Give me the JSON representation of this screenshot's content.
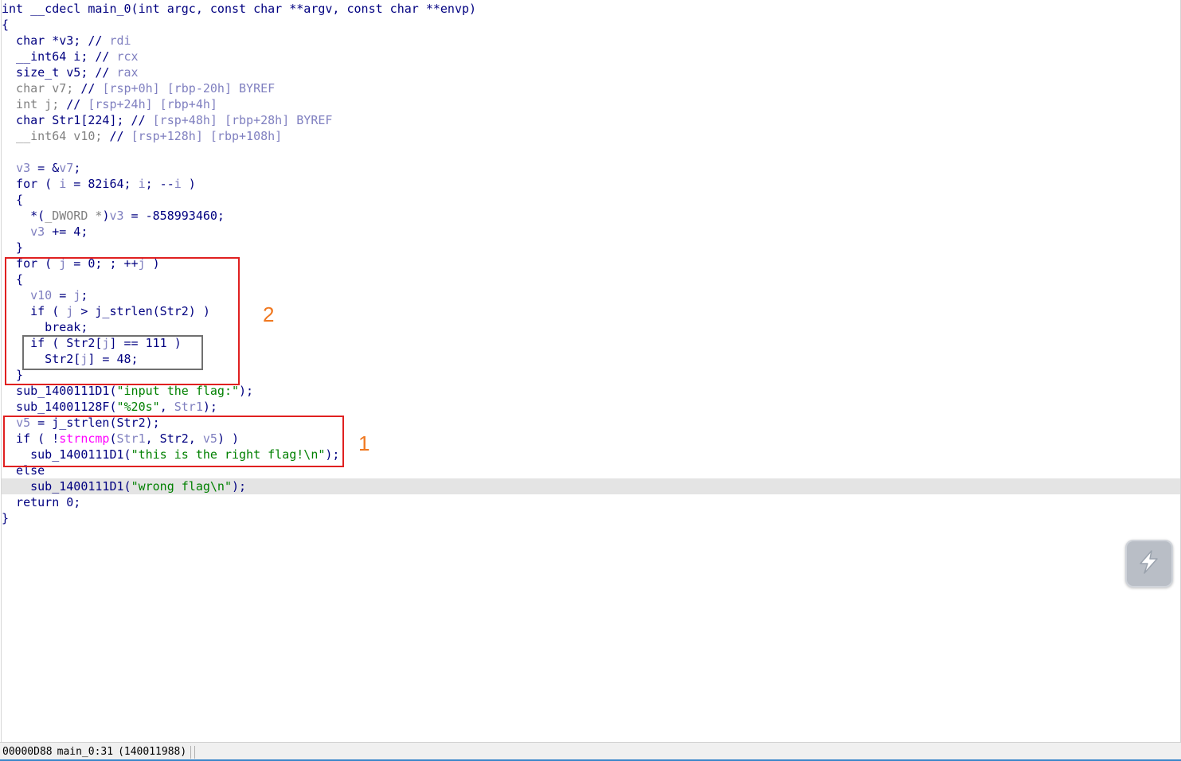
{
  "code_lines": [
    [
      [
        "int __cdecl main_0(int argc, const char **argv, const char **envp)",
        "kw"
      ]
    ],
    [
      [
        "{",
        "kw"
      ]
    ],
    [
      [
        "  char *v3; // ",
        "kw"
      ],
      [
        "rdi",
        "cmt"
      ]
    ],
    [
      [
        "  __int64 i; // ",
        "kw"
      ],
      [
        "rcx",
        "cmt"
      ]
    ],
    [
      [
        "  size_t v5; // ",
        "kw"
      ],
      [
        "rax",
        "cmt"
      ]
    ],
    [
      [
        "  char v7; ",
        "gray"
      ],
      [
        "// ",
        "kw"
      ],
      [
        "[rsp+0h] [rbp-20h] BYREF",
        "cmt"
      ]
    ],
    [
      [
        "  int j; ",
        "gray"
      ],
      [
        "// ",
        "kw"
      ],
      [
        "[rsp+24h] [rbp+4h]",
        "cmt"
      ]
    ],
    [
      [
        "  char Str1[224]; // ",
        "kw"
      ],
      [
        "[rsp+48h] [rbp+28h] BYREF",
        "cmt"
      ]
    ],
    [
      [
        "  __int64 v10; ",
        "gray"
      ],
      [
        "// ",
        "kw"
      ],
      [
        "[rsp+128h] [rbp+108h]",
        "cmt"
      ]
    ],
    [
      [
        "",
        "kw"
      ]
    ],
    [
      [
        "  ",
        "kw"
      ],
      [
        "v3",
        "var"
      ],
      [
        " = &",
        "kw"
      ],
      [
        "v7",
        "var"
      ],
      [
        ";",
        "kw"
      ]
    ],
    [
      [
        "  for ( ",
        "kw"
      ],
      [
        "i",
        "var"
      ],
      [
        " = 82i64; ",
        "kw"
      ],
      [
        "i",
        "var"
      ],
      [
        "; --",
        "kw"
      ],
      [
        "i",
        "var"
      ],
      [
        " )",
        "kw"
      ]
    ],
    [
      [
        "  {",
        "kw"
      ]
    ],
    [
      [
        "    *(",
        "kw"
      ],
      [
        "_DWORD *",
        "gray"
      ],
      [
        ")",
        "kw"
      ],
      [
        "v3",
        "var"
      ],
      [
        " = -858993460;",
        "kw"
      ]
    ],
    [
      [
        "    ",
        "kw"
      ],
      [
        "v3",
        "var"
      ],
      [
        " += 4;",
        "kw"
      ]
    ],
    [
      [
        "  }",
        "kw"
      ]
    ],
    [
      [
        "  for ( ",
        "kw"
      ],
      [
        "j",
        "var"
      ],
      [
        " = 0; ; ++",
        "kw"
      ],
      [
        "j",
        "var"
      ],
      [
        " )",
        "kw"
      ]
    ],
    [
      [
        "  {",
        "kw"
      ]
    ],
    [
      [
        "    ",
        "kw"
      ],
      [
        "v10",
        "var"
      ],
      [
        " = ",
        "kw"
      ],
      [
        "j",
        "var"
      ],
      [
        ";",
        "kw"
      ]
    ],
    [
      [
        "    if ( ",
        "kw"
      ],
      [
        "j",
        "var"
      ],
      [
        " > j_strlen(Str2) )",
        "kw"
      ]
    ],
    [
      [
        "      break;",
        "kw"
      ]
    ],
    [
      [
        "    if ( Str2[",
        "kw"
      ],
      [
        "j",
        "var"
      ],
      [
        "] == 111 )",
        "kw"
      ]
    ],
    [
      [
        "      Str2[",
        "kw"
      ],
      [
        "j",
        "var"
      ],
      [
        "] = 48;",
        "kw"
      ]
    ],
    [
      [
        "  }",
        "kw"
      ]
    ],
    [
      [
        "  sub_1400111D1(",
        "kw"
      ],
      [
        "\"input the flag:\"",
        "str"
      ],
      [
        ");",
        "kw"
      ]
    ],
    [
      [
        "  sub_14001128F(",
        "kw"
      ],
      [
        "\"%20s\"",
        "str"
      ],
      [
        ", ",
        "kw"
      ],
      [
        "Str1",
        "var"
      ],
      [
        ");",
        "kw"
      ]
    ],
    [
      [
        "  ",
        "kw"
      ],
      [
        "v5",
        "var"
      ],
      [
        " = j_strlen(Str2);",
        "kw"
      ]
    ],
    [
      [
        "  if ( !",
        "kw"
      ],
      [
        "strncmp",
        "imp"
      ],
      [
        "(",
        "kw"
      ],
      [
        "Str1",
        "var"
      ],
      [
        ", Str2, ",
        "kw"
      ],
      [
        "v5",
        "var"
      ],
      [
        ") )",
        "kw"
      ]
    ],
    [
      [
        "    sub_1400111D1(",
        "kw"
      ],
      [
        "\"this is the right flag!\\n\"",
        "str"
      ],
      [
        ");",
        "kw"
      ]
    ],
    [
      [
        "  else",
        "kw"
      ]
    ],
    [
      [
        "    sub_1400111D1(",
        "kw"
      ],
      [
        "\"wrong flag\\n\"",
        "str"
      ],
      [
        ");",
        "kw"
      ]
    ],
    [
      [
        "  return 0;",
        "kw"
      ]
    ],
    [
      [
        "}",
        "kw"
      ]
    ]
  ],
  "highlighted_line_index": 30,
  "annotations": {
    "box1_label": "1",
    "box2_label": "2"
  },
  "statusbar": {
    "address": "00000D88",
    "location": "main_0:31",
    "ea": "(140011988)"
  },
  "icons": {
    "fab": "lightning-bolt-icon"
  },
  "colors": {
    "keyword": "#000080",
    "variable": "#8080c0",
    "string": "#008000",
    "import": "#ff00ff",
    "highlight_bg": "#e4e4e4",
    "box_red": "#e02020",
    "annotation_orange": "#f07820"
  }
}
